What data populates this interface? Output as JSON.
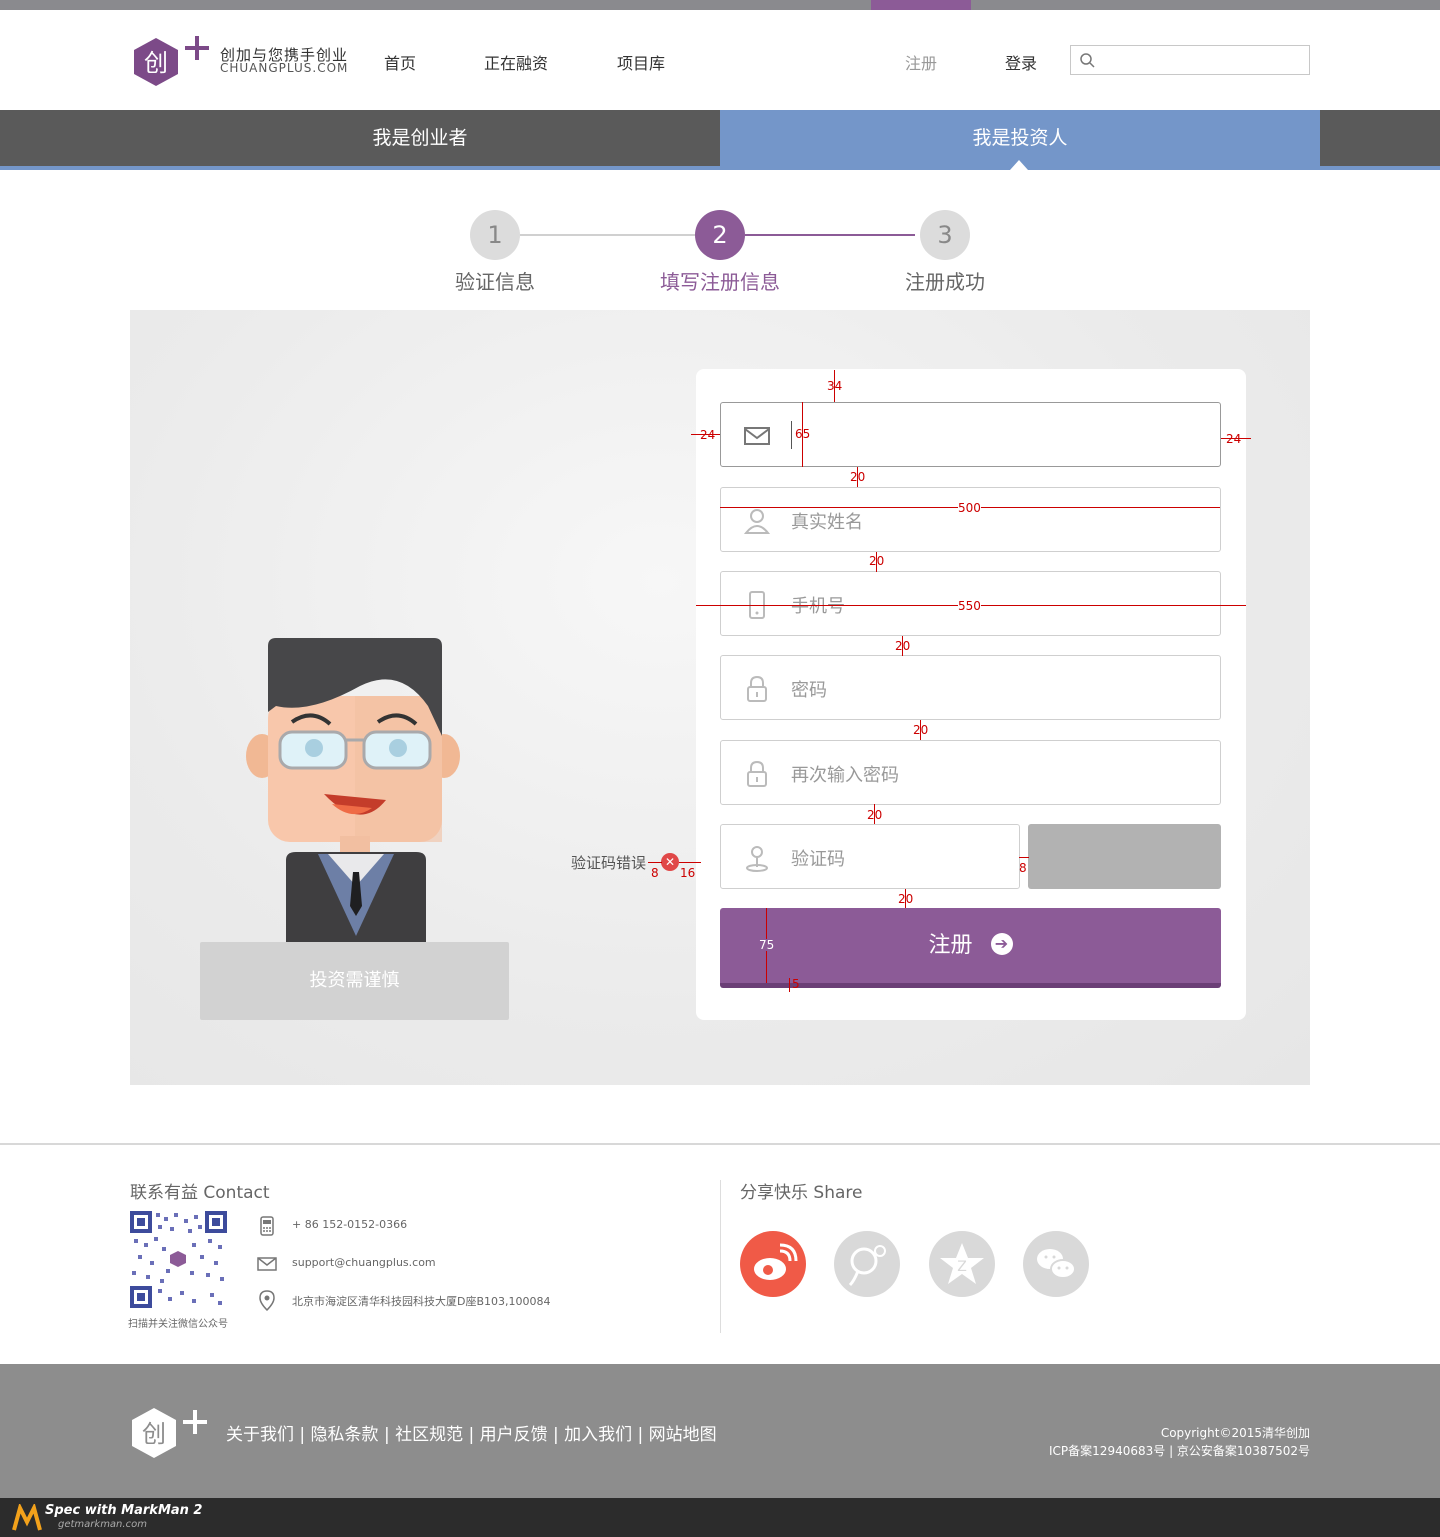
{
  "brand": {
    "name_cn": "创加与您携手创业",
    "name_en": "CHUANGPLUS.COM"
  },
  "nav": {
    "home": "首页",
    "funding": "正在融资",
    "projects": "项目库",
    "register": "注册",
    "login": "登录"
  },
  "tabs": {
    "entrepreneur": "我是创业者",
    "investor": "我是投资人"
  },
  "steps": [
    {
      "num": "1",
      "label": "验证信息"
    },
    {
      "num": "2",
      "label": "填写注册信息"
    },
    {
      "num": "3",
      "label": "注册成功"
    }
  ],
  "form": {
    "email_placeholder": "",
    "name_placeholder": "真实姓名",
    "phone_placeholder": "手机号",
    "password_placeholder": "密码",
    "password_repeat_placeholder": "再次输入密码",
    "captcha_placeholder": "验证码",
    "captcha_error": "验证码错误",
    "submit_label": "注册"
  },
  "illustration": {
    "plate_text": "投资需谨慎"
  },
  "measurements": [
    "34",
    "24",
    "65",
    "24",
    "20",
    "500",
    "20",
    "550",
    "20",
    "20",
    "20",
    "8",
    "16",
    "8",
    "20",
    "75",
    "5"
  ],
  "footer": {
    "contact_title": "联系有益 Contact",
    "qr_caption": "扫描并关注微信公众号",
    "phone": "+ 86 152-0152-0366",
    "email": "support@chuangplus.com",
    "address": "北京市海淀区清华科技园科技大厦D座B103,100084",
    "share_title": "分享快乐 Share",
    "share_icons": [
      "weibo-icon",
      "qq-weibo-icon",
      "qzone-icon",
      "wechat-icon"
    ],
    "links": "关于我们  |  隐私条款  |  社区规范  |  用户反馈  |  加入我们  |  网站地图",
    "copyright": "Copyright©2015清华创加",
    "icp": "ICP备案12940683号 | 京公安备案10387502号"
  },
  "colors": {
    "accent": "#8c5b97",
    "tab_active": "#7496c9",
    "tab_bg": "#5a5a5a",
    "footer_bg": "#8d8d8d"
  },
  "markman": {
    "title": "Spec with MarkMan 2",
    "url": "getmarkman.com"
  }
}
